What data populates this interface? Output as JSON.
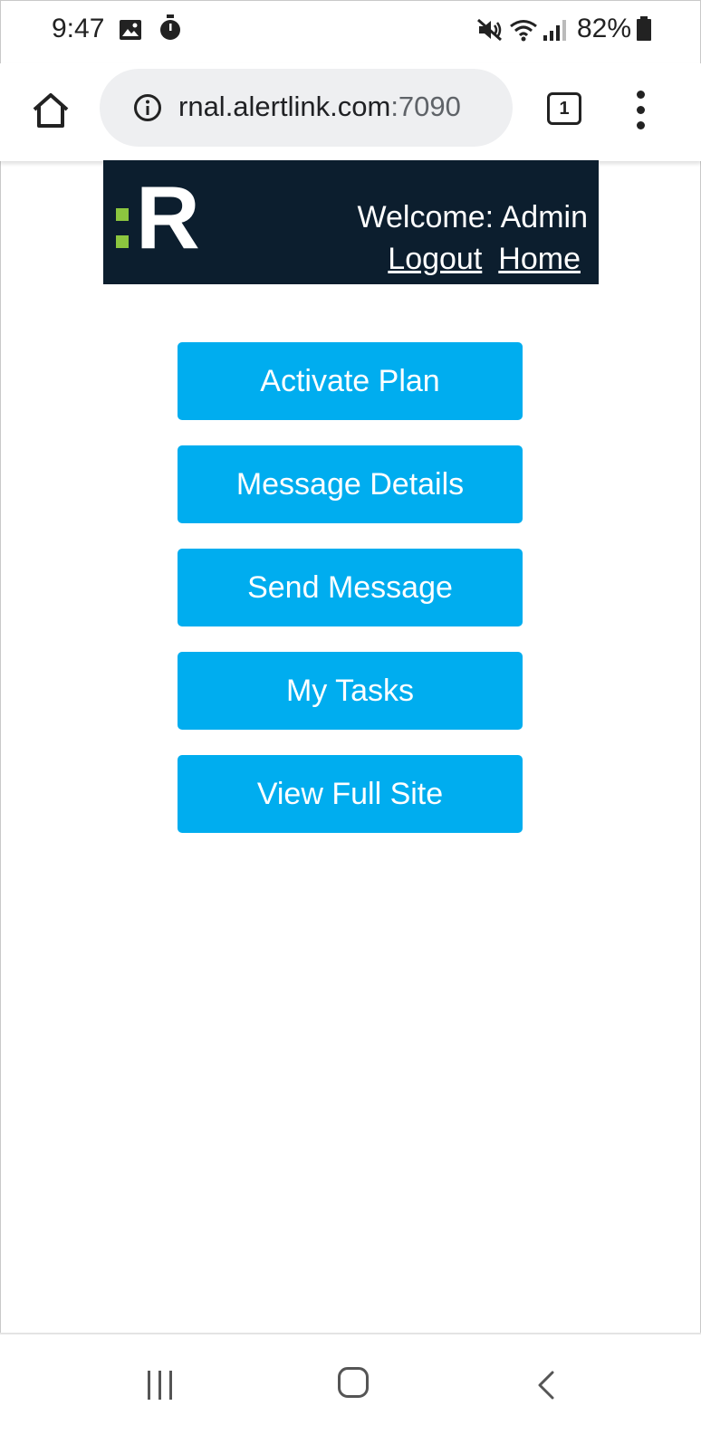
{
  "status_bar": {
    "time": "9:47",
    "battery": "82%",
    "icons": [
      "image-icon",
      "stopwatch-icon",
      "mute-icon",
      "wifi-icon",
      "signal-icon",
      "battery-icon"
    ]
  },
  "browser": {
    "url_host": "rnal.alertlink.com",
    "url_port": ":7090",
    "tab_count": "1"
  },
  "site": {
    "logo_letter": "R",
    "welcome": "Welcome: Admin",
    "logout_label": "Logout",
    "home_label": "Home",
    "colors": {
      "header_bg": "#0c1e2e",
      "logo_accent": "#8cc63f",
      "button_bg": "#00adef"
    }
  },
  "menu": {
    "activate_plan": "Activate Plan",
    "message_details": "Message Details",
    "send_message": "Send Message",
    "my_tasks": "My Tasks",
    "view_full_site": "View Full Site"
  },
  "nav": {
    "icons": [
      "recent-apps-icon",
      "home-circle-icon",
      "back-icon"
    ]
  }
}
